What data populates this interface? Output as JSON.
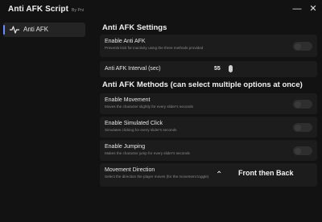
{
  "app": {
    "title": "Anti AFK Script",
    "subtitle": "By Pni"
  },
  "window_controls": {
    "minimize": "—",
    "close": "✕"
  },
  "sidebar": {
    "items": [
      {
        "label": "Anti AFK",
        "icon": "activity-icon",
        "selected": true
      }
    ]
  },
  "accent_color": "#6b8cff",
  "settings_section": {
    "title": "Anti AFK Settings",
    "enable": {
      "title": "Enable Anti AFK",
      "description": "Prevents kick for inactivity using the three methods provided",
      "enabled": false
    },
    "interval": {
      "label": "Anti AFK Interval (sec)",
      "value": "55"
    }
  },
  "methods_section": {
    "title": "Anti AFK Methods (can select multiple options at once)",
    "items": [
      {
        "title": "Enable Movement",
        "description": "Moves the character slightly for every slider's seconds",
        "enabled": false
      },
      {
        "title": "Enable Simulated Click",
        "description": "Simulates clicking for every slider's seconds",
        "enabled": false
      },
      {
        "title": "Enable Jumping",
        "description": "Makes the character jump for every slider's seconds",
        "enabled": false
      }
    ],
    "direction": {
      "title": "Movement Direction",
      "description": "Select the direction the player moves (for the movement toggle)",
      "value": "Front then Back"
    }
  }
}
